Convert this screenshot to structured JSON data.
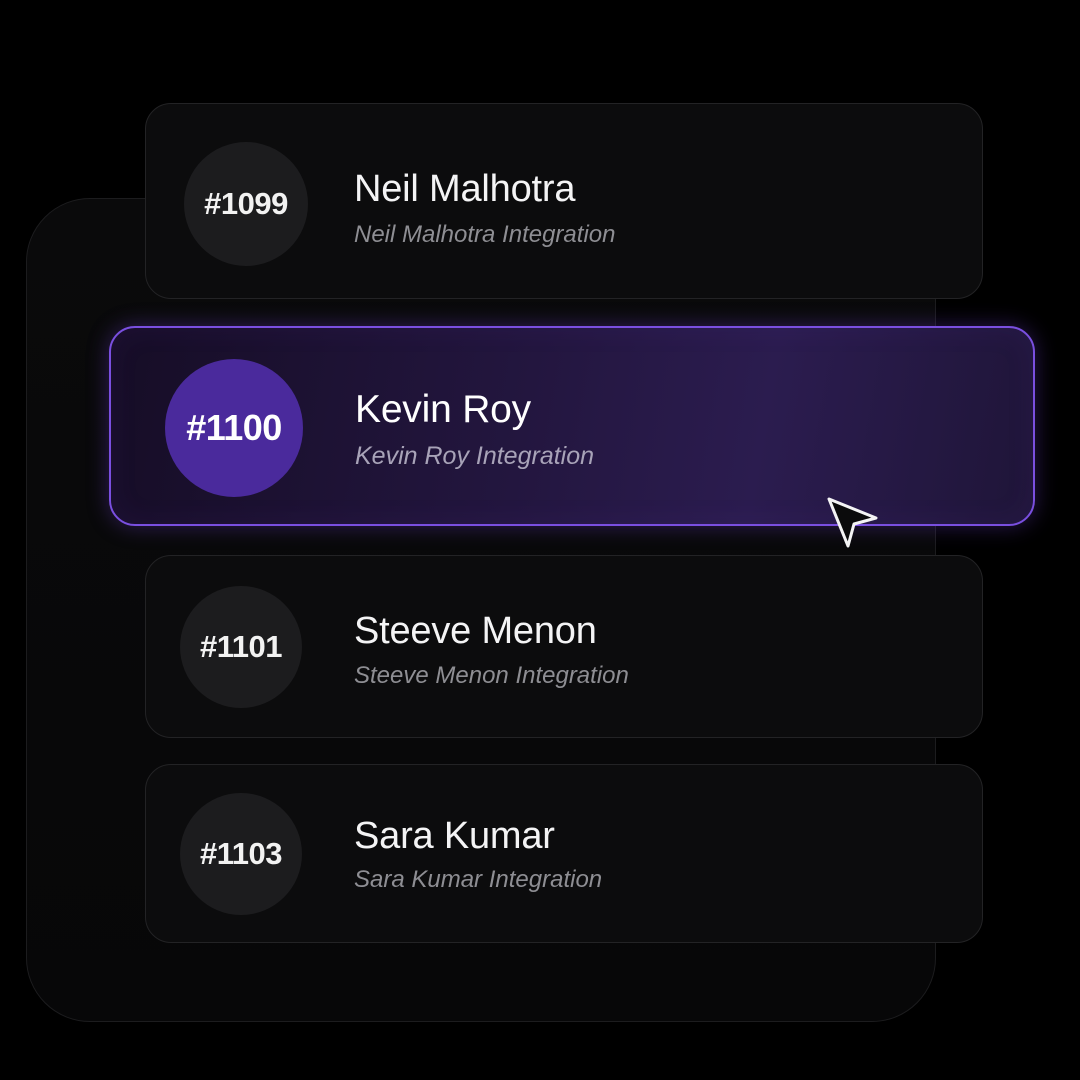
{
  "list": {
    "items": [
      {
        "id": "#1099",
        "name": "Neil Malhotra",
        "subtitle": "Neil Malhotra Integration",
        "selected": false
      },
      {
        "id": "#1100",
        "name": "Kevin Roy",
        "subtitle": "Kevin Roy Integration",
        "selected": true
      },
      {
        "id": "#1101",
        "name": "Steeve Menon",
        "subtitle": "Steeve Menon Integration",
        "selected": false
      },
      {
        "id": "#1103",
        "name": "Sara Kumar",
        "subtitle": "Sara Kumar Integration",
        "selected": false
      }
    ]
  },
  "colors": {
    "background": "#000000",
    "card": "#0c0c0d",
    "accent": "#7a4fe0",
    "accent_badge": "#4a2a9c"
  },
  "icons": {
    "pointer": "mouse-pointer-icon"
  }
}
